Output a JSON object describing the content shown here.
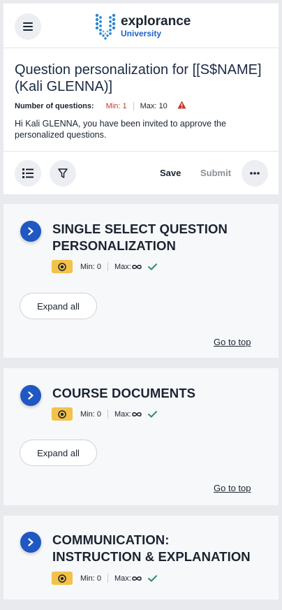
{
  "logo": {
    "word1": "explorance",
    "word2": "University"
  },
  "header": {
    "title": "Question personalization for [[S$NAME] (Kali GLENNA)]",
    "num_questions_label": "Number of questions:",
    "min": "Min: 1",
    "max": "Max: 10",
    "intro": "Hi Kali GLENNA, you have been invited to approve the personalized questions."
  },
  "toolbar": {
    "save_label": "Save",
    "submit_label": "Submit"
  },
  "sections": [
    {
      "title": "SINGLE SELECT QUESTION PERSONALIZATION",
      "min": "Min: 0",
      "max": "Max:",
      "expand": "Expand all",
      "goto": "Go to top"
    },
    {
      "title": "COURSE DOCUMENTS",
      "min": "Min: 0",
      "max": "Max:",
      "expand": "Expand all",
      "goto": "Go to top"
    },
    {
      "title": "COMMUNICATION: INSTRUCTION & EXPLANATION",
      "min": "Min: 0",
      "max": "Max:"
    }
  ],
  "colors": {
    "accent": "#1f57c3",
    "badge": "#f2c24a",
    "warning": "#c0392b",
    "check": "#2e8b6e"
  },
  "icons": [
    "hamburger-icon",
    "list-icon",
    "filter-icon",
    "more-icon",
    "chevron-right-icon",
    "warning-icon",
    "target-icon",
    "infinity-icon",
    "check-icon"
  ]
}
